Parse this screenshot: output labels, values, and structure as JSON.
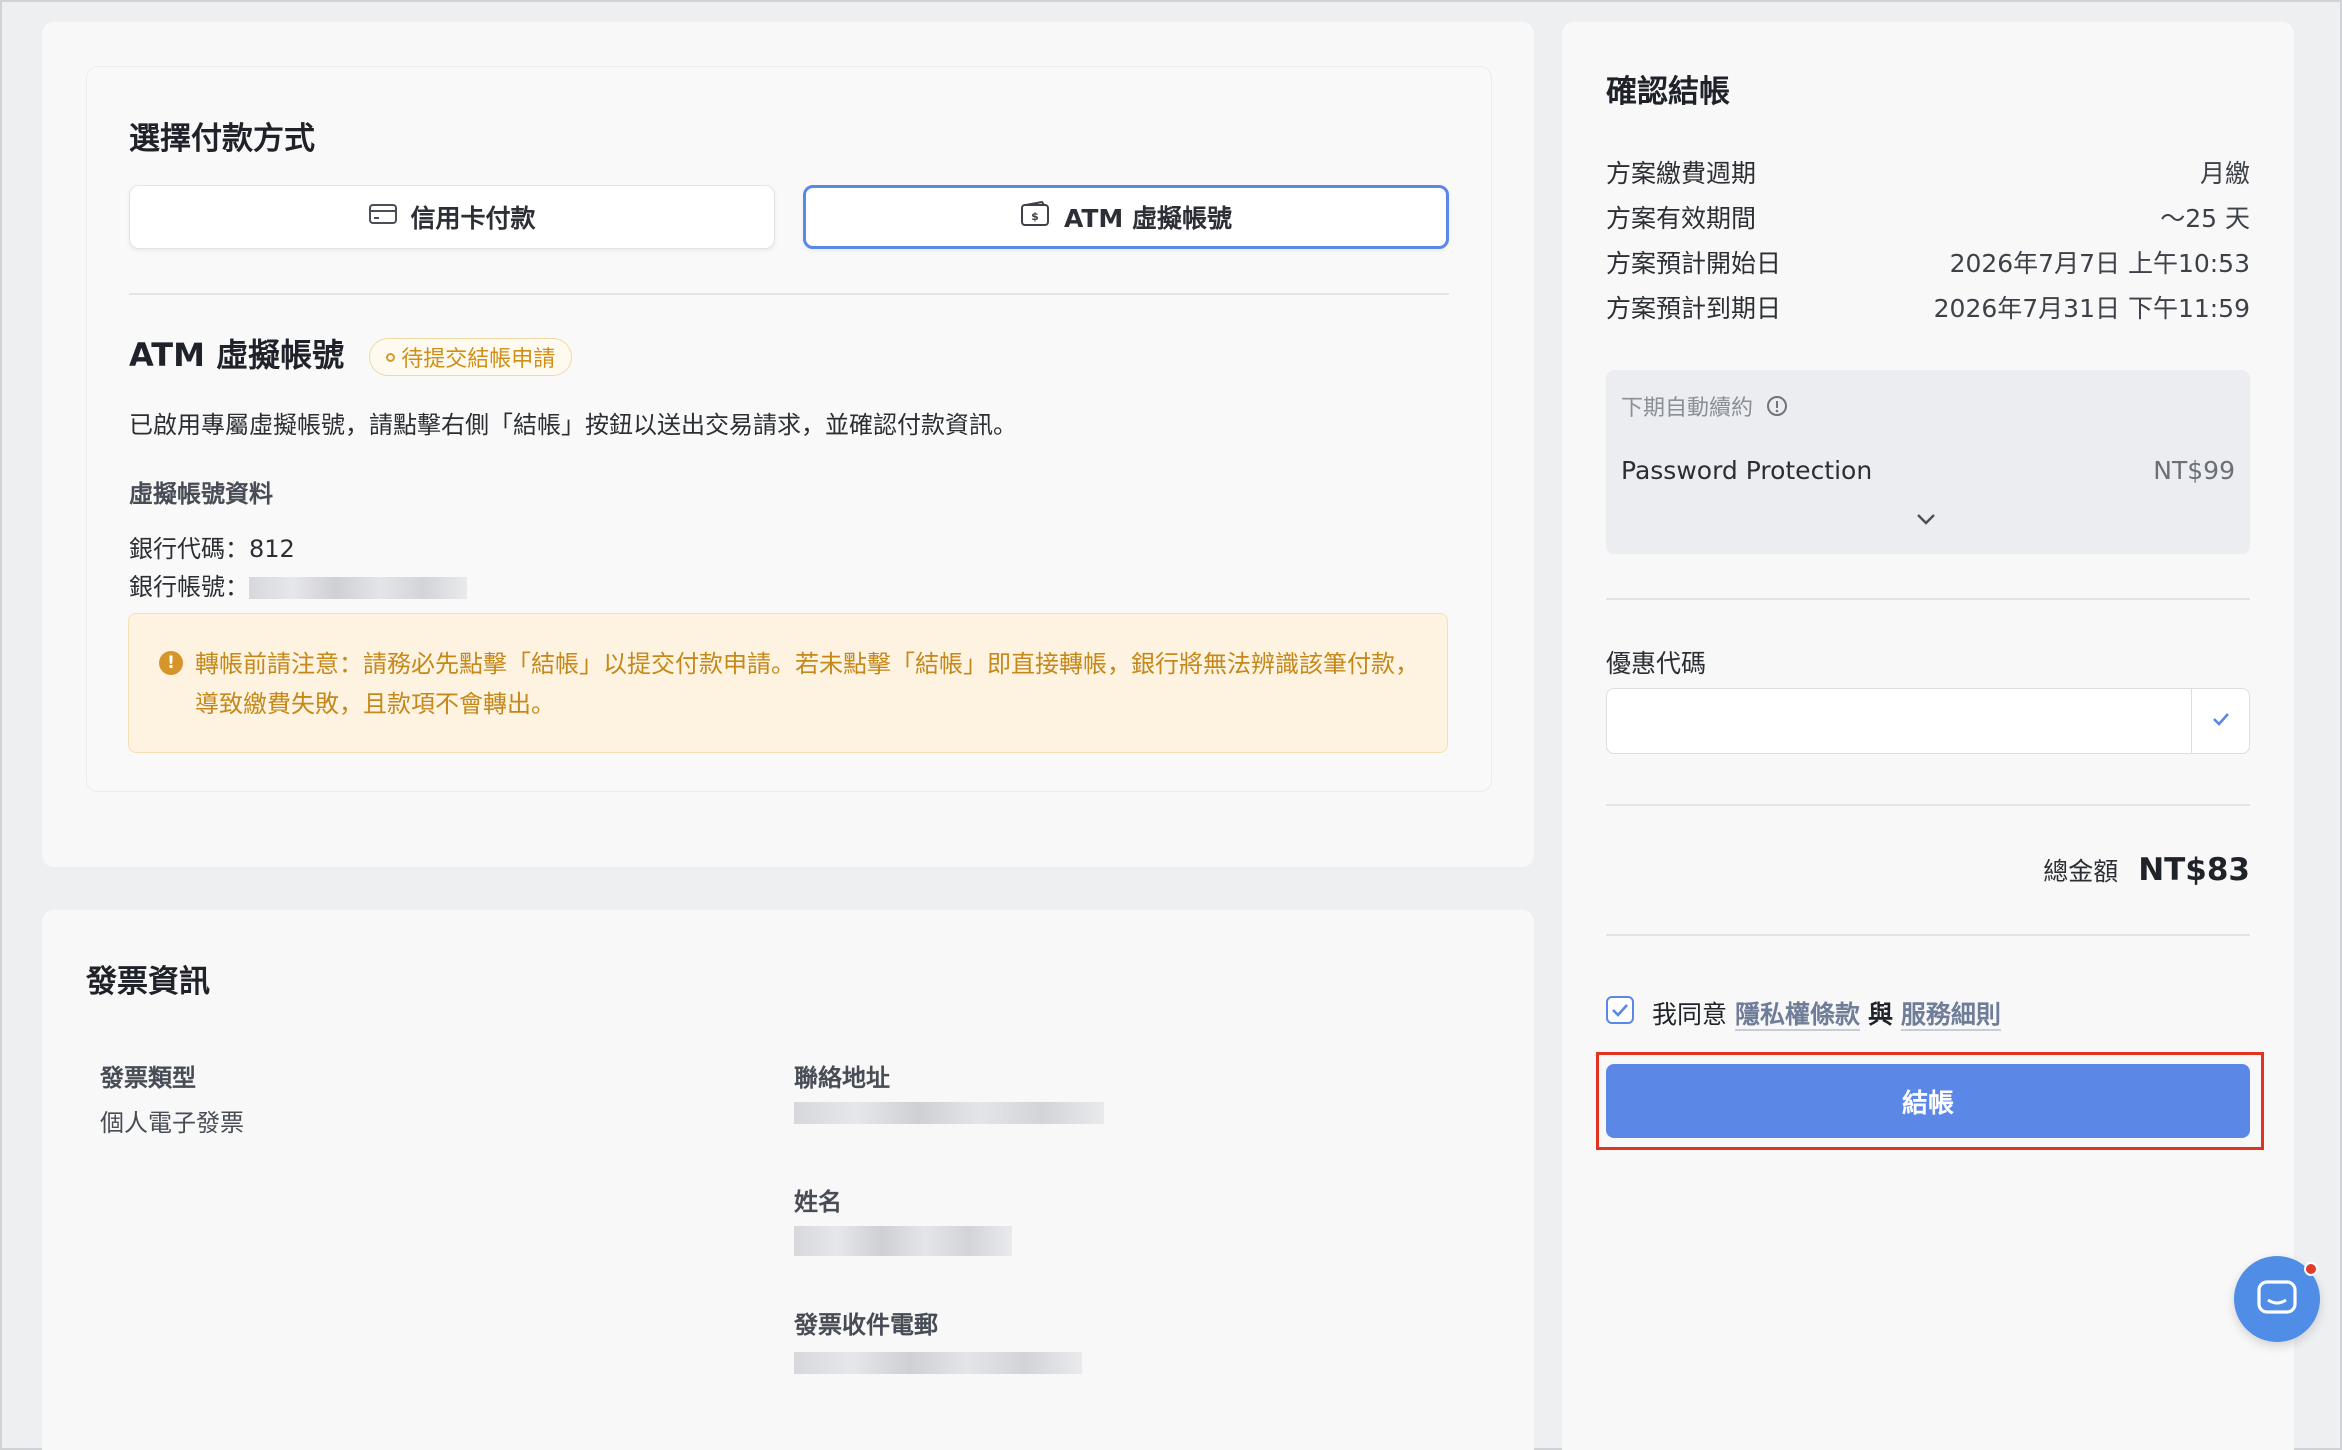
{
  "payment": {
    "title": "選擇付款方式",
    "credit_card_label": "信用卡付款",
    "atm_label": "ATM 虛擬帳號",
    "atm_heading": "ATM 虛擬帳號",
    "status_badge": "待提交結帳申請",
    "description": "已啟用專屬虛擬帳號，請點擊右側「結帳」按鈕以送出交易請求，並確認付款資訊。",
    "account_section_title": "虛擬帳號資料",
    "bank_code_label": "銀行代碼：",
    "bank_code_value": "812",
    "bank_account_label": "銀行帳號：",
    "notice": "轉帳前請注意：請務必先點擊「結帳」以提交付款申請。若未點擊「結帳」即直接轉帳，銀行將無法辨識該筆付款，導致繳費失敗，且款項不會轉出。"
  },
  "invoice": {
    "title": "發票資訊",
    "type_label": "發票類型",
    "type_value": "個人電子發票",
    "address_label": "聯絡地址",
    "name_label": "姓名",
    "email_label": "發票收件電郵"
  },
  "summary": {
    "title": "確認結帳",
    "rows": [
      {
        "label": "方案繳費週期",
        "value": "月繳"
      },
      {
        "label": "方案有效期間",
        "value": "～25 天"
      },
      {
        "label": "方案預計開始日",
        "value": "2026年7月7日 上午10:53"
      },
      {
        "label": "方案預計到期日",
        "value": "2026年7月31日 下午11:59"
      }
    ],
    "renew_label": "下期自動續約",
    "renew_item": "Password Protection",
    "renew_price": "NT$99",
    "coupon_label": "優惠代碼",
    "coupon_placeholder": "",
    "total_label": "總金額",
    "total_value": "NT$83",
    "agree_prefix": "我同意",
    "privacy_link": "隱私權條款",
    "and_text": "與",
    "terms_link": "服務細則",
    "checkout_label": "結帳"
  },
  "colors": {
    "accent": "#5b87e6",
    "warning": "#c5881a",
    "highlight": "#e0341f"
  }
}
